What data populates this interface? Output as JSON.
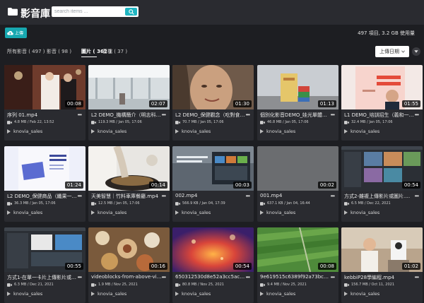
{
  "header": {
    "title": "影音庫",
    "search": {
      "placeholder": "search items ..."
    }
  },
  "toolbar": {
    "upload_label": "上傳",
    "stats": "497 項目, 3.2 GB 使用量"
  },
  "tabs": [
    {
      "label": "所有影音 ( 497 )"
    },
    {
      "label": "影音 ( 98 )"
    },
    {
      "label": "圖片 ( 362 )"
    },
    {
      "label": "音檔 ( 37 )"
    }
  ],
  "sort": {
    "selected": "上傳日期"
  },
  "colors": {
    "accent": "#1fb5c1",
    "background": "#1d1e22",
    "card": "#2a2b30"
  },
  "items": [
    {
      "title": "序列 01.mp4",
      "meta": "4.8 MB / Feb 22, 13:52",
      "duration": "00:08",
      "owner": "knovia_sales"
    },
    {
      "title": "L2 DEMO_機構簡介（明志科大...",
      "meta": "119.3 MB / Jan 05, 17:06",
      "duration": "02:07",
      "owner": "knovia_sales"
    },
    {
      "title": "L2 DEMO_保健觀念（吃對食物...",
      "meta": "70.7 MB / Jan 05, 17:06",
      "duration": "01:30",
      "owner": "knovia_sales"
    },
    {
      "title": "個別化影音DEMO_娃光單體喇...",
      "meta": "46.8 MB / Jan 05, 17:06",
      "duration": "01:13",
      "owner": "knovia_sales"
    },
    {
      "title": "L1 DEMO_培訓招生（義和一招...",
      "meta": "32.4 MB / Jan 05, 17:06",
      "duration": "01:55",
      "owner": "knovia_sales"
    },
    {
      "title": "L2 DEMO_保健商品（纖果一基...",
      "meta": "36.3 MB / Jan 05, 17:06",
      "duration": "01:24",
      "owner": "knovia_sales"
    },
    {
      "title": "天美智慧｜竹料車庫餐廳.mp4",
      "meta": "12.5 MB / Jan 05, 17:06",
      "duration": "00:14",
      "owner": "knovia_sales"
    },
    {
      "title": "002.mp4",
      "meta": "566.9 KB / Jan 04, 17:39",
      "duration": "00:03",
      "owner": "knovia_sales"
    },
    {
      "title": "001.mp4",
      "meta": "637.1 KB / Jan 04, 16:44",
      "duration": "00:02",
      "owner": "knovia_sales"
    },
    {
      "title": "方式2-雜複上傳影片或圖片.mp4",
      "meta": "6.5 MB / Dec 22, 2021",
      "duration": "00:54",
      "owner": "knovia_sales"
    },
    {
      "title": "方式1-在單一卡片上傳影片或圖...",
      "meta": "6.3 MB / Dec 21, 2021",
      "duration": "00:55",
      "owner": "knovia_sales"
    },
    {
      "title": "videoblocks-from-above-vie...",
      "meta": "1.9 MB / Nov 25, 2021",
      "duration": "00:16",
      "owner": "knovia_sales"
    },
    {
      "title": "650312530d8e52a3cc5acbbd...",
      "meta": "80.8 MB / Nov 25, 2021",
      "duration": "00:54",
      "owner": "knovia_sales"
    },
    {
      "title": "9e619515c6389f92a73bc9f6d8...",
      "meta": "9.4 MB / Nov 25, 2021",
      "duration": "00:08",
      "owner": "knovia_sales"
    },
    {
      "title": "kebbiP28學編程.mp4",
      "meta": "156.7 MB / Oct 11, 2021",
      "duration": "01:02",
      "owner": "knovia_sales"
    }
  ]
}
